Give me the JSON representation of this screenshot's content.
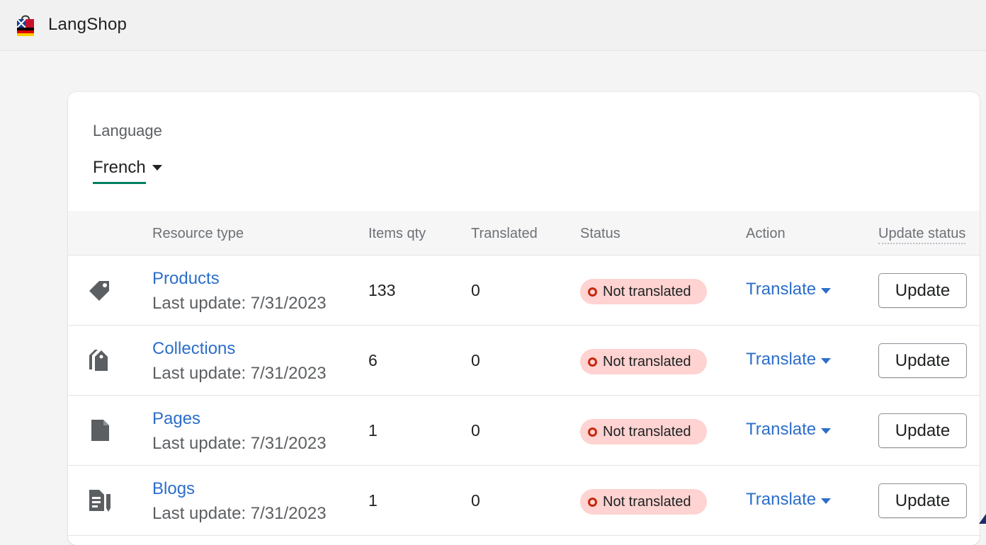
{
  "app": {
    "title": "LangShop",
    "logo_icon": "shopping-bag-flag-icon"
  },
  "language": {
    "label": "Language",
    "selected": "French"
  },
  "table": {
    "headers": {
      "resource_type": "Resource type",
      "items_qty": "Items qty",
      "translated": "Translated",
      "status": "Status",
      "action": "Action",
      "update_status": "Update status"
    },
    "rows": [
      {
        "icon": "tag-icon",
        "name": "Products",
        "last_update": "Last update: 7/31/2023",
        "items_qty": "133",
        "translated": "0",
        "status": "Not translated",
        "action": "Translate",
        "update": "Update"
      },
      {
        "icon": "collection-tags-icon",
        "name": "Collections",
        "last_update": "Last update: 7/31/2023",
        "items_qty": "6",
        "translated": "0",
        "status": "Not translated",
        "action": "Translate",
        "update": "Update"
      },
      {
        "icon": "page-icon",
        "name": "Pages",
        "last_update": "Last update: 7/31/2023",
        "items_qty": "1",
        "translated": "0",
        "status": "Not translated",
        "action": "Translate",
        "update": "Update"
      },
      {
        "icon": "blog-icon",
        "name": "Blogs",
        "last_update": "Last update: 7/31/2023",
        "items_qty": "1",
        "translated": "0",
        "status": "Not translated",
        "action": "Translate",
        "update": "Update"
      }
    ]
  },
  "colors": {
    "link": "#2c6ecb",
    "badge_bg": "#fed3d1",
    "badge_dot": "#c5280c",
    "tab_underline": "#008060"
  }
}
